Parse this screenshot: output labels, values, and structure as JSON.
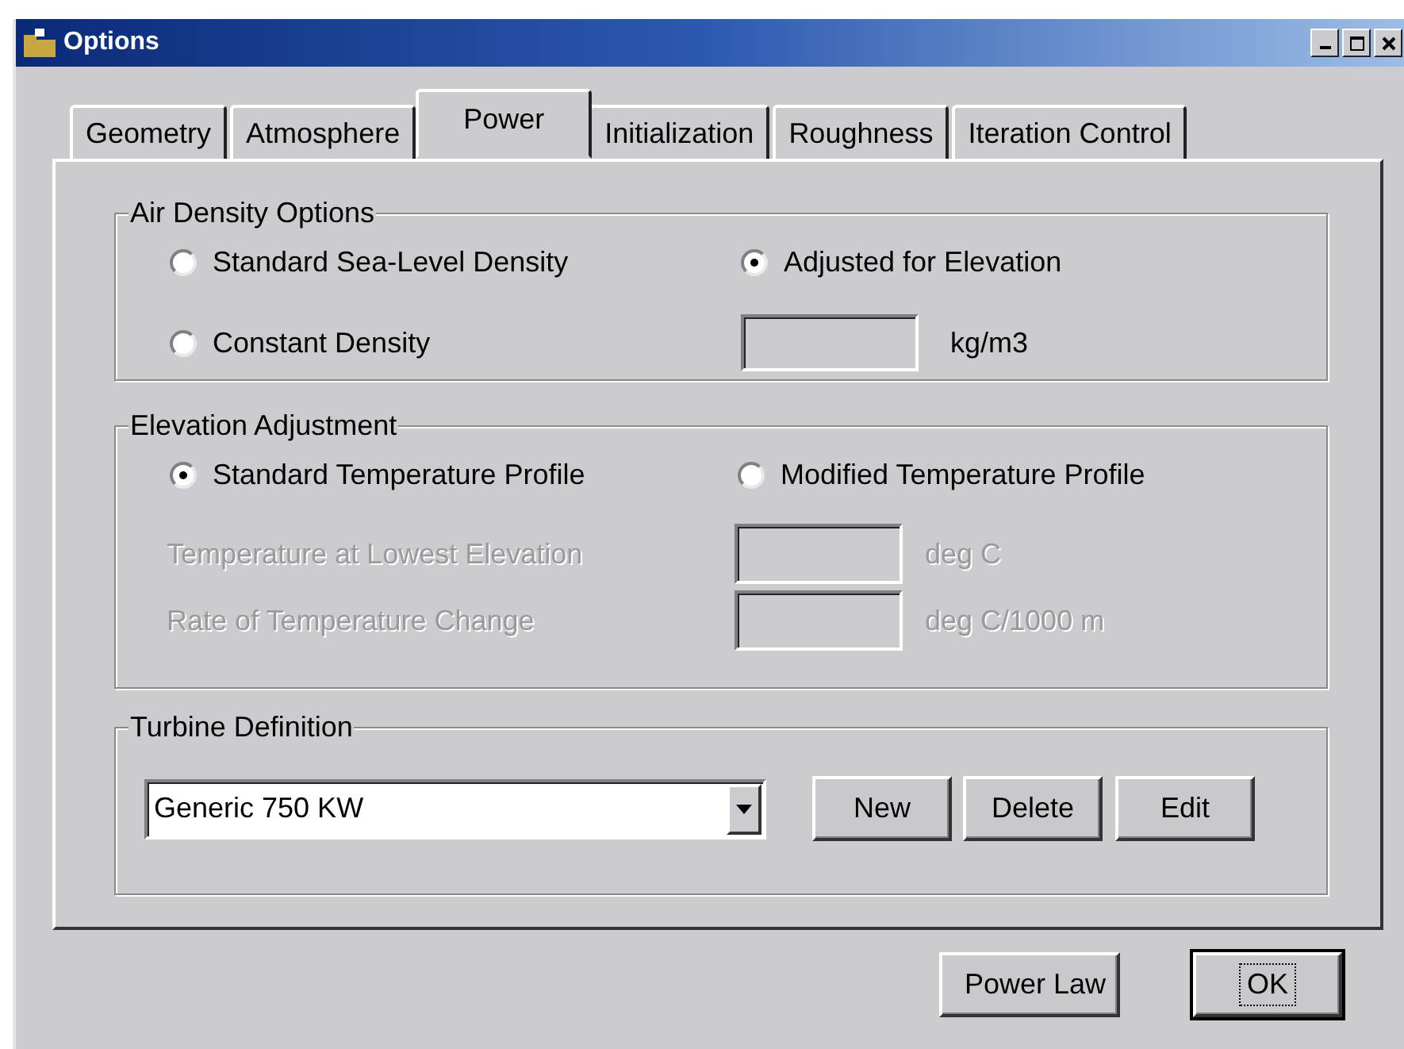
{
  "window": {
    "title": "Options"
  },
  "tabs": [
    {
      "label": "Geometry",
      "selected": false
    },
    {
      "label": "Atmosphere",
      "selected": false
    },
    {
      "label": "Power",
      "selected": true
    },
    {
      "label": "Initialization",
      "selected": false
    },
    {
      "label": "Roughness",
      "selected": false
    },
    {
      "label": "Iteration Control",
      "selected": false
    }
  ],
  "air_density": {
    "title": "Air Density Options",
    "options": [
      {
        "label": "Standard Sea-Level Density",
        "selected": false
      },
      {
        "label": "Adjusted for Elevation",
        "selected": true
      },
      {
        "label": "Constant Density",
        "selected": false
      }
    ],
    "unit": "kg/m3"
  },
  "elevation": {
    "title": "Elevation Adjustment",
    "options": [
      {
        "label": "Standard Temperature Profile",
        "selected": true
      },
      {
        "label": "Modified Temperature Profile",
        "selected": false
      }
    ],
    "fields": [
      {
        "label": "Temperature at Lowest Elevation",
        "unit": "deg C",
        "disabled": true
      },
      {
        "label": "Rate of Temperature Change",
        "unit": "deg C/1000 m",
        "disabled": true
      }
    ]
  },
  "turbine": {
    "title": "Turbine Definition",
    "dropdown": {
      "value": "Generic 750 KW"
    },
    "buttons": [
      {
        "label": "New"
      },
      {
        "label": "Delete"
      },
      {
        "label": "Edit"
      }
    ]
  },
  "footer_buttons": [
    {
      "label": "Power Law",
      "default": false
    },
    {
      "label": "OK",
      "default": true
    }
  ]
}
